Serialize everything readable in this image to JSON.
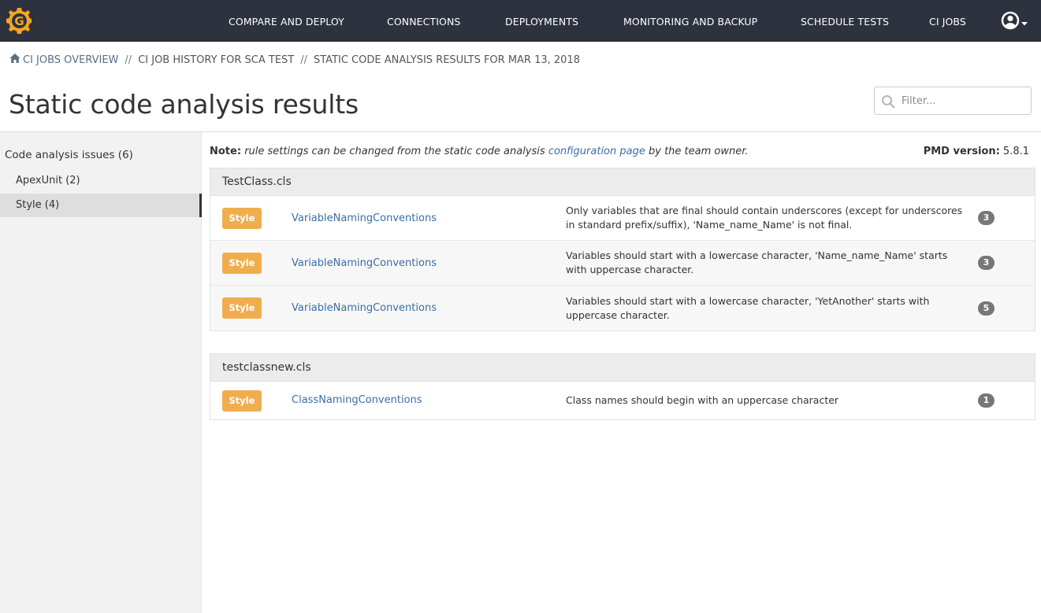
{
  "nav": {
    "items": [
      {
        "label": "COMPARE AND DEPLOY"
      },
      {
        "label": "CONNECTIONS"
      },
      {
        "label": "DEPLOYMENTS"
      },
      {
        "label": "MONITORING AND BACKUP"
      },
      {
        "label": "SCHEDULE TESTS"
      },
      {
        "label": "CI JOBS"
      }
    ],
    "logo_letter": "G",
    "logo_color": "#f5a623",
    "bg_color": "#2d323e"
  },
  "breadcrumb": {
    "home_icon": "home-icon",
    "items": [
      {
        "label": "CI JOBS OVERVIEW"
      },
      {
        "label": "CI JOB HISTORY FOR SCA TEST"
      },
      {
        "label": "STATIC CODE ANALYSIS RESULTS FOR MAR 13, 2018"
      }
    ],
    "separator": "//"
  },
  "page": {
    "title": "Static code analysis results"
  },
  "filter": {
    "placeholder": "Filter...",
    "value": "",
    "icon": "search-icon"
  },
  "sidebar": {
    "heading": "Code analysis issues (6)",
    "items": [
      {
        "label": "ApexUnit (2)",
        "active": false
      },
      {
        "label": "Style (4)",
        "active": true
      }
    ]
  },
  "note": {
    "prefix": "Note:",
    "text_before": "rule settings can be changed from the static code analysis",
    "link": "configuration page",
    "text_after": "by the team owner."
  },
  "pmd": {
    "label": "PMD version:",
    "value": "5.8.1"
  },
  "files": [
    {
      "name": "TestClass.cls",
      "issues": [
        {
          "category": "Style",
          "rule": "VariableNamingConventions",
          "description": "Only variables that are final should contain underscores (except for underscores in standard prefix/suffix), 'Name_name_Name' is not final.",
          "count": "3"
        },
        {
          "category": "Style",
          "rule": "VariableNamingConventions",
          "description": "Variables should start with a lowercase character, 'Name_name_Name' starts with uppercase character.",
          "count": "3"
        },
        {
          "category": "Style",
          "rule": "VariableNamingConventions",
          "description": "Variables should start with a lowercase character, 'YetAnother' starts with uppercase character.",
          "count": "5"
        }
      ]
    },
    {
      "name": "testclassnew.cls",
      "issues": [
        {
          "category": "Style",
          "rule": "ClassNamingConventions",
          "description": "Class names should begin with an uppercase character",
          "count": "1"
        }
      ]
    }
  ],
  "colors": {
    "badge_style": "#f0ad4e",
    "link": "#3a6ea5",
    "count_badge": "#777777"
  }
}
